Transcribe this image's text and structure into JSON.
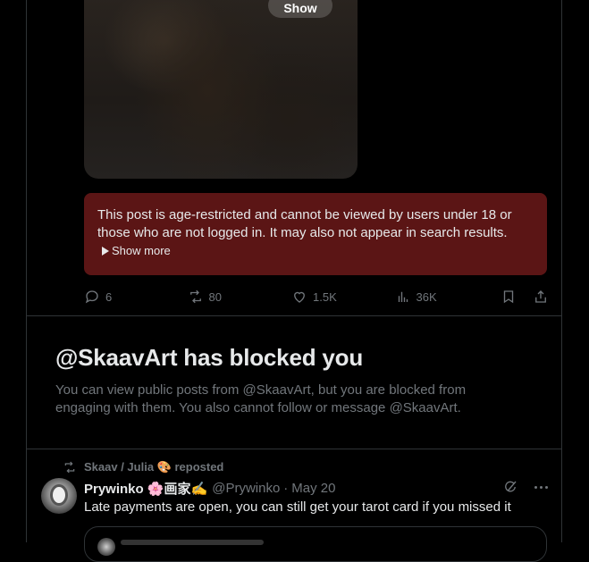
{
  "post1": {
    "show_label": "Show",
    "restricted_text": "This post is age-restricted and cannot be viewed by users under 18 or those who are not logged in. It may also not appear in search results.",
    "show_more_label": "Show more",
    "actions": {
      "replies": "6",
      "reposts": "80",
      "likes": "1.5K",
      "views": "36K"
    },
    "restricted_bg": "#5b1515"
  },
  "blocked": {
    "title": "@SkaavArt has blocked you",
    "description": "You can view public posts from @SkaavArt, but you are blocked from engaging with them. You also cannot follow or message @SkaavArt."
  },
  "post2": {
    "repost_line": "Skaav / Julia 🎨 reposted",
    "author": "Prywinko 🌸画家✍️",
    "handle": "@Prywinko",
    "separator": "·",
    "date": "May 20",
    "text": "Late payments are open, you can still get your tarot card if you missed it"
  },
  "colors": {
    "background": "#000000",
    "border": "#2f3336",
    "muted_text": "#71767b",
    "primary_text": "#e7e9ea"
  }
}
